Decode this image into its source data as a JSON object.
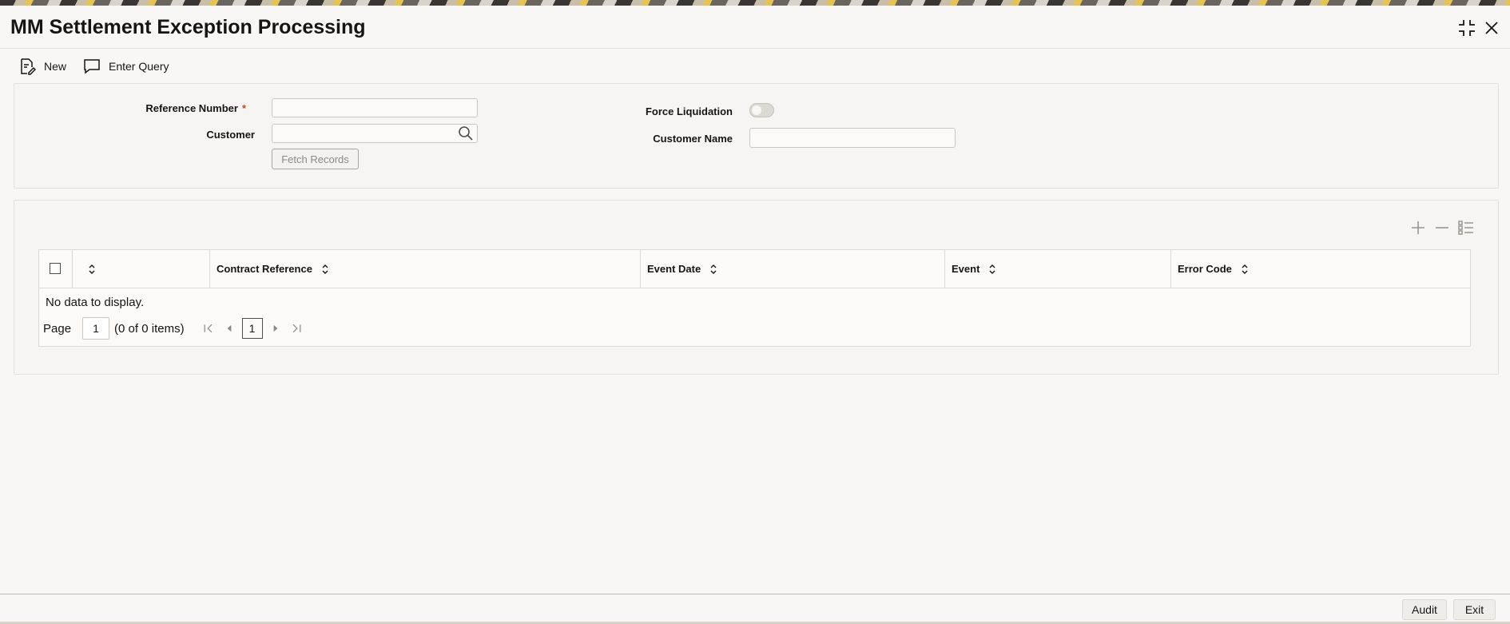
{
  "window": {
    "title": "MM Settlement Exception Processing",
    "controls": [
      "restore-icon",
      "close-icon"
    ]
  },
  "toolbar": {
    "new_label": "New",
    "enter_query_label": "Enter Query"
  },
  "form": {
    "reference_number_label": "Reference Number",
    "reference_number_value": "",
    "required_mark": "*",
    "customer_label": "Customer",
    "customer_value": "",
    "fetch_records_label": "Fetch Records",
    "force_liquidation_label": "Force Liquidation",
    "force_liquidation_on": false,
    "customer_name_label": "Customer Name",
    "customer_name_value": ""
  },
  "grid": {
    "tools": [
      "add-row-icon",
      "remove-row-icon",
      "column-list-icon"
    ],
    "columns": [
      "",
      "Contract Reference",
      "Event Date",
      "Event",
      "Error Code"
    ],
    "rows": [],
    "empty_text": "No data to display.",
    "pager": {
      "page_label": "Page",
      "page_value": "1",
      "items_text": "(0 of 0 items)",
      "current_page": "1"
    }
  },
  "footer": {
    "audit_label": "Audit",
    "exit_label": "Exit"
  },
  "colors": {
    "text": "#161513",
    "required": "#c74634",
    "panel_bg": "#f6f5f3",
    "page_bg": "#f8f7f5"
  }
}
